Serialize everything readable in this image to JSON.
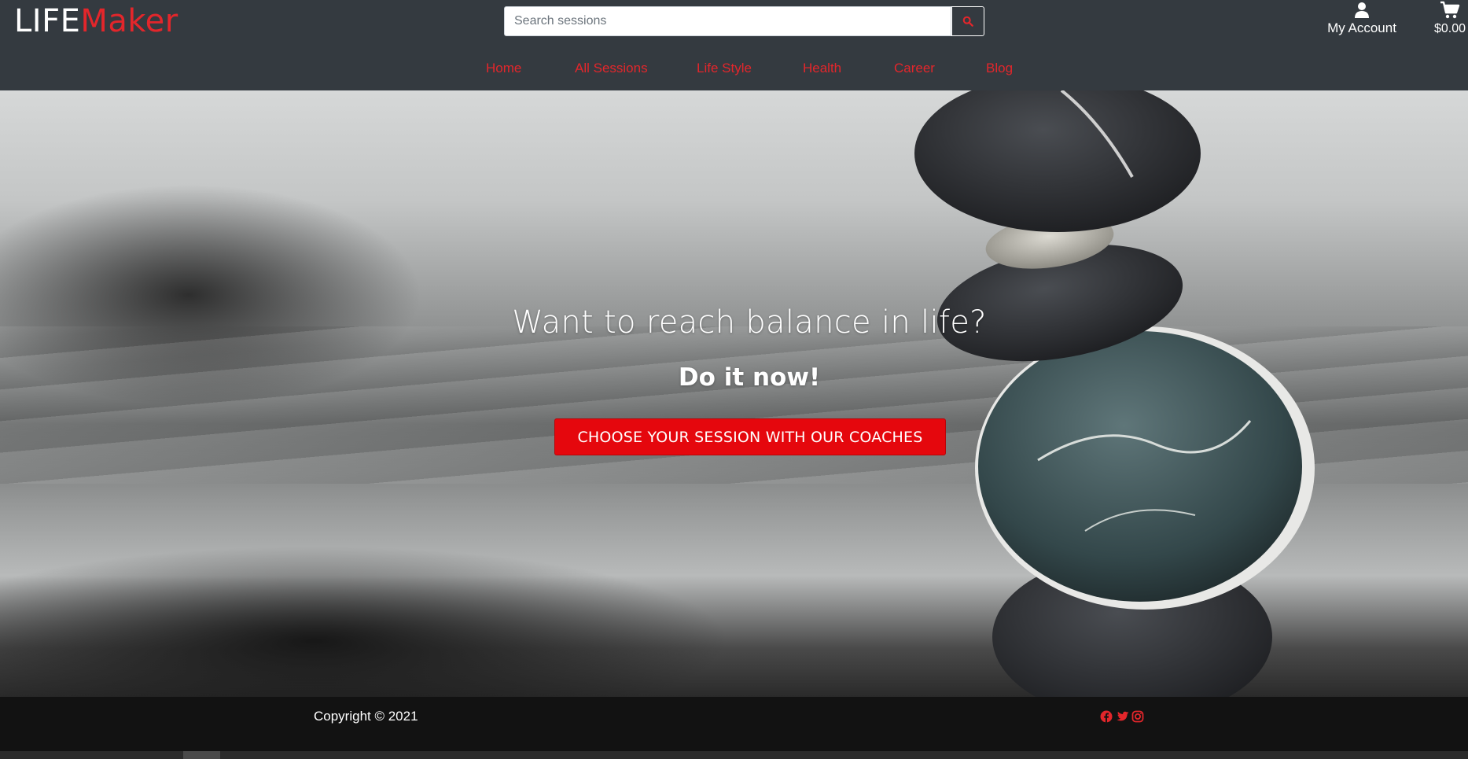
{
  "brand": {
    "part1": "LIFE",
    "part2": "Maker"
  },
  "search": {
    "placeholder": "Search sessions",
    "icon": "search-icon"
  },
  "account": {
    "label": "My Account",
    "icon": "user-icon"
  },
  "cart": {
    "total": "$0.00",
    "icon": "cart-icon"
  },
  "nav": {
    "items": [
      {
        "label": "Home"
      },
      {
        "label": "All Sessions"
      },
      {
        "label": "Life Style"
      },
      {
        "label": "Health"
      },
      {
        "label": "Career"
      },
      {
        "label": "Blog"
      }
    ]
  },
  "hero": {
    "title": "Want to reach balance in life?",
    "subtitle": "Do it now!",
    "cta_label": "CHOOSE YOUR SESSION WITH OUR COACHES"
  },
  "footer": {
    "copyright": "Copyright © 2021",
    "social": [
      "facebook-icon",
      "twitter-icon",
      "instagram-icon"
    ]
  },
  "colors": {
    "header_bg": "#343a40",
    "accent": "#e3262b",
    "cta_bg": "#e5070d",
    "footer_bg": "#121212"
  }
}
